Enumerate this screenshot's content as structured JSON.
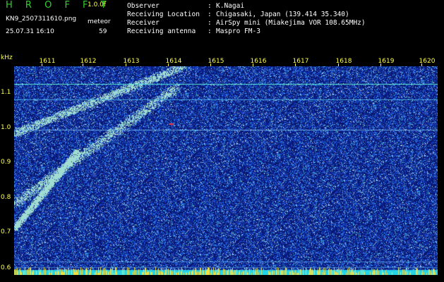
{
  "header": {
    "app_title": "H R O F F T",
    "version": "1.0.0f",
    "filename": "KN9_2507311610.png",
    "mode": "meteor",
    "datetime": "25.07.31 16:10",
    "count": "59",
    "meta": [
      {
        "label": "Observer",
        "value": "K.Nagai"
      },
      {
        "label": "Receiving Location",
        "value": "Chigasaki, Japan (139.414 35.340)"
      },
      {
        "label": "Receiver",
        "value": "AirSpy mini (Miakejima VOR 108.65MHz)"
      },
      {
        "label": "Receiving antenna",
        "value": "Maspro FM-3"
      }
    ]
  },
  "axes": {
    "y_unit": "kHz",
    "x_ticks": [
      "1611",
      "1612",
      "1613",
      "1614",
      "1615",
      "1616",
      "1617",
      "1618",
      "1619",
      "1620"
    ],
    "y_ticks": [
      "1.1",
      "1.0",
      "0.9",
      "0.8",
      "0.7",
      "0.6"
    ]
  },
  "colors": {
    "background": "#000000",
    "label_yellow": "#ffff4a",
    "title_green": "#2fd02f",
    "spectrogram_blue": "#0a1a7a",
    "noise_band_cyan": "#26d4e8"
  }
}
